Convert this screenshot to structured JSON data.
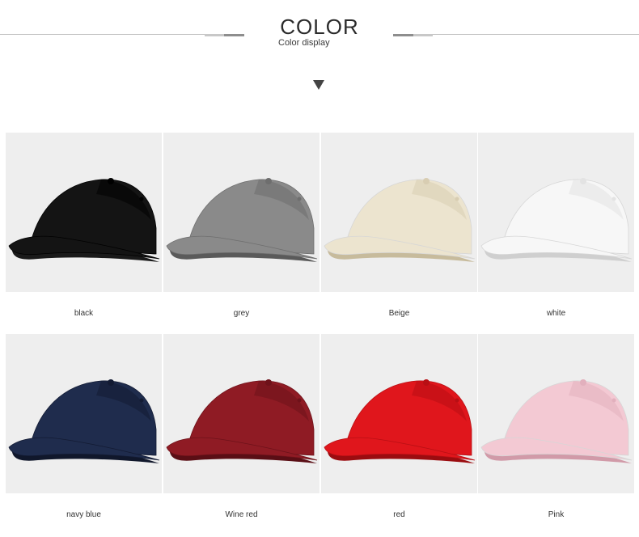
{
  "header": {
    "title": "COLOR",
    "subtitle": "Color display",
    "arrow_icon": "triangle-down-icon"
  },
  "swatches": [
    {
      "label": "black",
      "color": "#141414",
      "shade": "#000000",
      "under": "#1a1a1a"
    },
    {
      "label": "grey",
      "color": "#8a8a8a",
      "shade": "#6e6e6e",
      "under": "#5a5a5a"
    },
    {
      "label": "Beige",
      "color": "#ece4cf",
      "shade": "#d8cdb2",
      "under": "#c7bb9c"
    },
    {
      "label": "white",
      "color": "#f7f7f7",
      "shade": "#e3e3e3",
      "under": "#cfcfcf"
    },
    {
      "label": "navy blue",
      "color": "#1f2c4d",
      "shade": "#131b33",
      "under": "#10172b"
    },
    {
      "label": "Wine red",
      "color": "#8f1b24",
      "shade": "#6e121a",
      "under": "#5a0e15"
    },
    {
      "label": "red",
      "color": "#e0161c",
      "shade": "#b80f14",
      "under": "#9b0c10"
    },
    {
      "label": "Pink",
      "color": "#f3c9d3",
      "shade": "#e2b0bd",
      "under": "#d19aa8"
    }
  ]
}
